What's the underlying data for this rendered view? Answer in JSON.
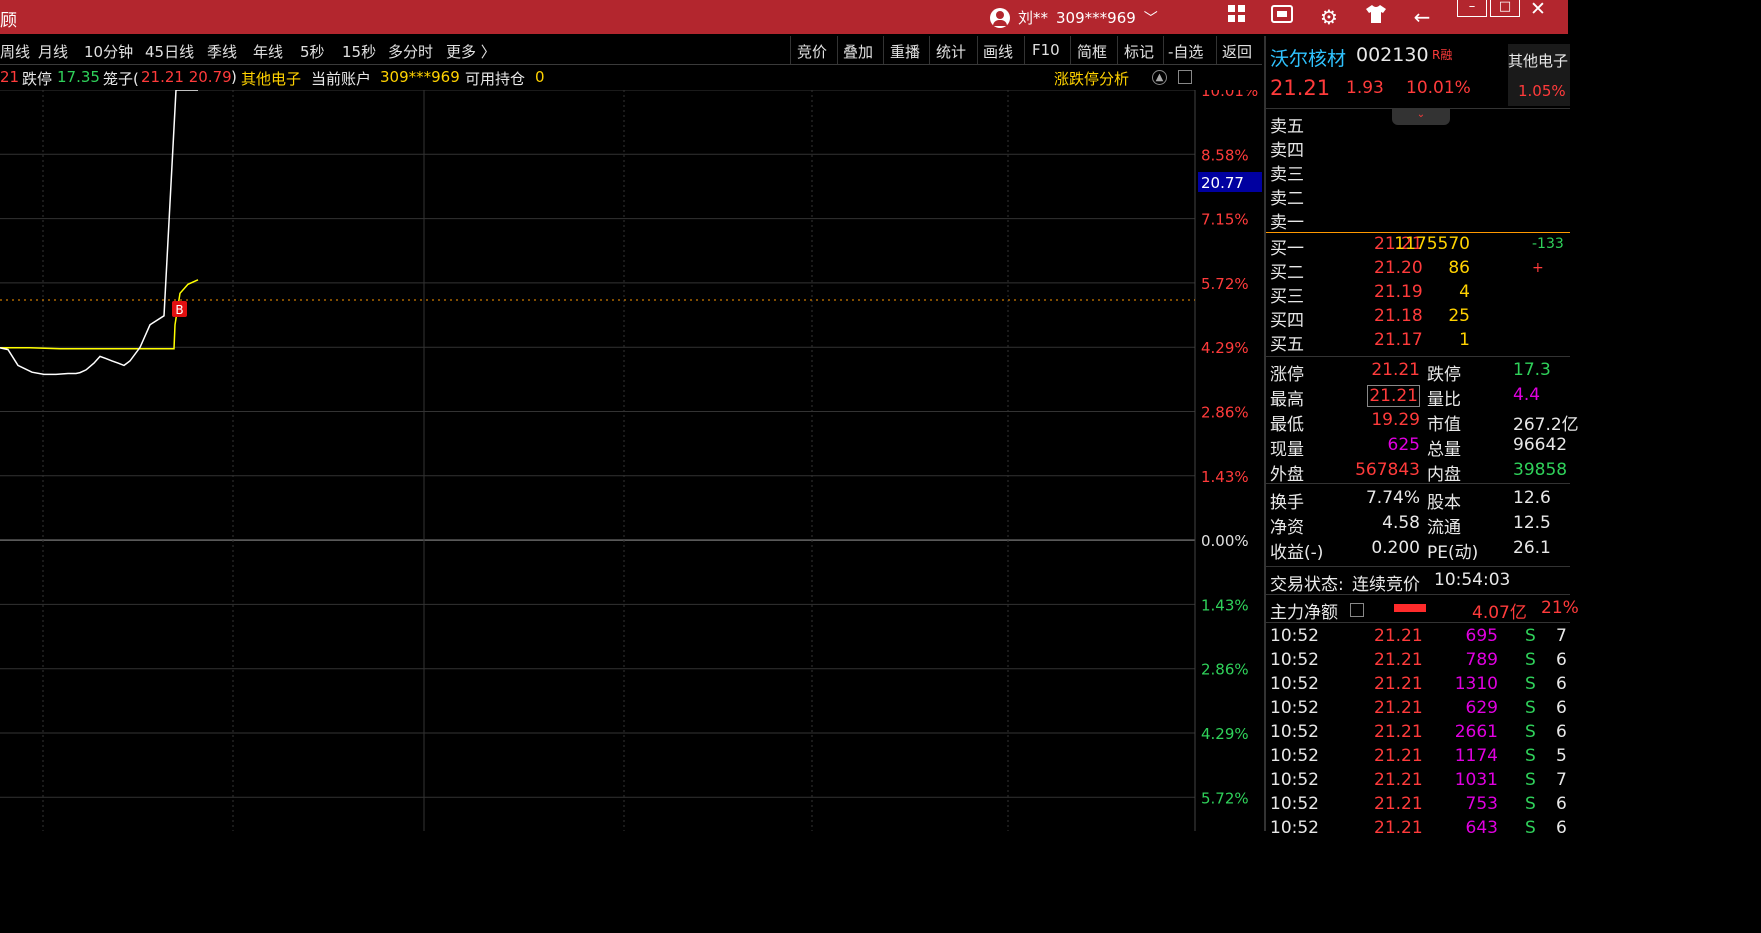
{
  "titlebar": {
    "title": "顾",
    "user_name": "刘**",
    "account": "309***969",
    "icons": [
      "grid-icon",
      "badge-icon",
      "gear-icon",
      "shirt-icon",
      "back-arrow-icon"
    ],
    "min_label": "–",
    "max_label": "□",
    "close_label": "✕"
  },
  "menu_left": [
    "周线",
    "月线",
    "10分钟",
    "45日线",
    "季线",
    "年线",
    "5秒",
    "15秒",
    "多分时",
    "更多 〉"
  ],
  "menu_right": [
    "竞价",
    "叠加",
    "重播",
    "统计",
    "画线",
    "F10",
    "简框",
    "标记",
    "-自选",
    "返回"
  ],
  "info": {
    "prefix": "21",
    "limit_down_label": "跌停",
    "limit_down_value": "17.35",
    "cage_label": "笼子(",
    "cage_values": "21.21 20.79",
    "cage_close": ")",
    "sector": "其他电子",
    "account_label": "当前账户",
    "account_value": "309***969",
    "position_label": "可用持仓",
    "position_value": "0",
    "analysis_link": "涨跌停分析"
  },
  "axis": {
    "right_labels": [
      "10.01%",
      "8.58%",
      "7.15%",
      "5.72%",
      "4.29%",
      "2.86%",
      "1.43%",
      "0.00%",
      "1.43%",
      "2.86%",
      "4.29%",
      "5.72%"
    ],
    "price_marker": "20.77",
    "trade_marker": "B"
  },
  "stock": {
    "name": "沃尔核材",
    "code": "002130",
    "tag": "R融",
    "price": "21.21",
    "change": "1.93",
    "change_pct": "10.01%",
    "sector": "其他电子",
    "sector_pct": "1.05%"
  },
  "sell_levels": [
    "卖五",
    "卖四",
    "卖三",
    "卖二",
    "卖一"
  ],
  "buy_levels": [
    {
      "label": "买一",
      "price": "21.21",
      "vol": "1175570",
      "chg": "-133"
    },
    {
      "label": "买二",
      "price": "21.20",
      "vol": "86",
      "chg": "+"
    },
    {
      "label": "买三",
      "price": "21.19",
      "vol": "4",
      "chg": ""
    },
    {
      "label": "买四",
      "price": "21.18",
      "vol": "25",
      "chg": ""
    },
    {
      "label": "买五",
      "price": "21.17",
      "vol": "1",
      "chg": ""
    }
  ],
  "stats": [
    {
      "l1": "涨停",
      "v1": "21.21",
      "l2": "跌停",
      "v2": "17.3"
    },
    {
      "l1": "最高",
      "v1": "21.21",
      "l2": "量比",
      "v2": "4.4"
    },
    {
      "l1": "最低",
      "v1": "19.29",
      "l2": "市值",
      "v2": "267.2亿"
    },
    {
      "l1": "现量",
      "v1": "625",
      "l2": "总量",
      "v2": "96642"
    },
    {
      "l1": "外盘",
      "v1": "567843",
      "l2": "内盘",
      "v2": "39858"
    },
    {
      "l1": "换手",
      "v1": "7.74%",
      "l2": "股本",
      "v2": "12.6"
    },
    {
      "l1": "净资",
      "v1": "4.58",
      "l2": "流通",
      "v2": "12.5"
    },
    {
      "l1": "收益(-)",
      "v1": "0.200",
      "l2": "PE(动)",
      "v2": "26.1"
    }
  ],
  "status": {
    "label": "交易状态:",
    "value": "连续竞价",
    "time": "10:54:03"
  },
  "net": {
    "label": "主力净额",
    "amount": "4.07亿",
    "pct": "21%"
  },
  "ticks": [
    {
      "time": "10:52",
      "price": "21.21",
      "vol": "695",
      "side": "S",
      "num": "7"
    },
    {
      "time": "10:52",
      "price": "21.21",
      "vol": "789",
      "side": "S",
      "num": "6"
    },
    {
      "time": "10:52",
      "price": "21.21",
      "vol": "1310",
      "side": "S",
      "num": "6"
    },
    {
      "time": "10:52",
      "price": "21.21",
      "vol": "629",
      "side": "S",
      "num": "6"
    },
    {
      "time": "10:52",
      "price": "21.21",
      "vol": "2661",
      "side": "S",
      "num": "6"
    },
    {
      "time": "10:52",
      "price": "21.21",
      "vol": "1174",
      "side": "S",
      "num": "5"
    },
    {
      "time": "10:52",
      "price": "21.21",
      "vol": "1031",
      "side": "S",
      "num": "7"
    },
    {
      "time": "10:52",
      "price": "21.21",
      "vol": "753",
      "side": "S",
      "num": "6"
    },
    {
      "time": "10:52",
      "price": "21.21",
      "vol": "643",
      "side": "S",
      "num": "6"
    }
  ],
  "chart_data": {
    "type": "line",
    "y_axis_pct_top": 10.01,
    "y_axis_pct_bottom": -5.72,
    "series": [
      {
        "values": [
          4.29,
          4.25,
          3.9,
          3.75,
          3.7,
          3.7,
          3.72,
          3.72,
          3.74,
          3.8,
          3.95,
          4.1,
          4.05,
          4.0,
          3.95,
          3.9,
          4.0,
          4.3,
          4.8,
          5.0,
          10.01,
          10.01,
          10.01
        ]
      },
      {
        "values": [
          4.29,
          4.29,
          4.29,
          4.27,
          4.27,
          4.27,
          4.27,
          4.27,
          4.27,
          4.27,
          4.27,
          4.27,
          4.27,
          4.27,
          4.27,
          4.27,
          4.27,
          4.27,
          4.27,
          4.8,
          5.5,
          5.7,
          5.8
        ]
      }
    ]
  }
}
